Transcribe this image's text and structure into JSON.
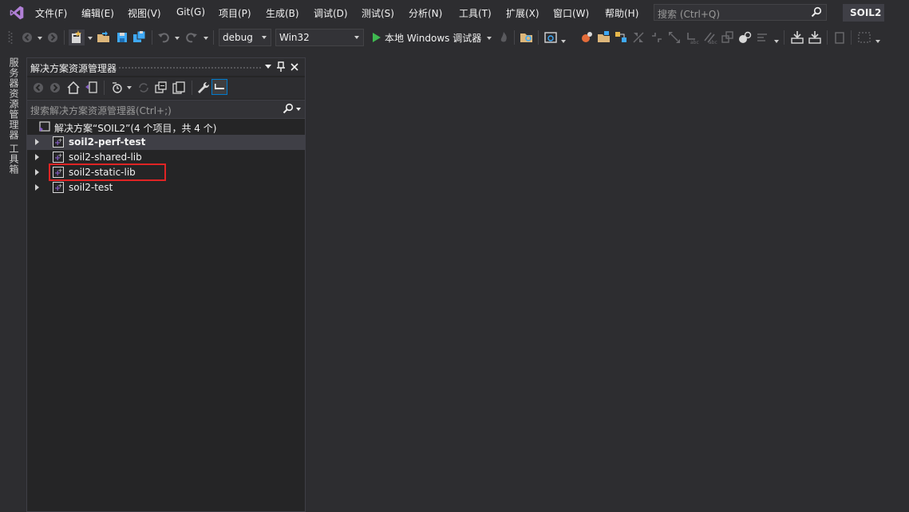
{
  "menu": {
    "items": [
      "文件(F)",
      "编辑(E)",
      "视图(V)",
      "Git(G)",
      "项目(P)",
      "生成(B)",
      "调试(D)",
      "测试(S)",
      "分析(N)",
      "工具(T)",
      "扩展(X)",
      "窗口(W)",
      "帮助(H)"
    ]
  },
  "search": {
    "placeholder": "搜索 (Ctrl+Q)"
  },
  "solution_badge": "SOIL2",
  "toolbar": {
    "config": "debug",
    "platform": "Win32",
    "run_label": "本地 Windows 调试器"
  },
  "side_tabs": {
    "server_explorer": "服务器资源管理器",
    "toolbox": "工具箱"
  },
  "solution_explorer": {
    "title": "解决方案资源管理器",
    "search_placeholder": "搜索解决方案资源管理器(Ctrl+;)",
    "solution_node": "解决方案“SOIL2”(4 个项目，共 4 个)",
    "projects": [
      {
        "name": "soil2-perf-test",
        "bold": true,
        "selected": true
      },
      {
        "name": "soil2-shared-lib",
        "bold": false,
        "selected": false
      },
      {
        "name": "soil2-static-lib",
        "bold": false,
        "selected": false,
        "highlighted": true
      },
      {
        "name": "soil2-test",
        "bold": false,
        "selected": false
      }
    ]
  },
  "colors": {
    "accent": "#007acc",
    "vs_purple": "#865fc5",
    "highlight": "#e02424",
    "run_green": "#3fb950"
  }
}
